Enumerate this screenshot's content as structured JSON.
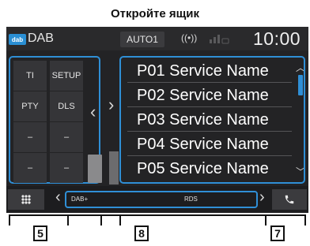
{
  "heading": "Откройте ящик",
  "status_bar": {
    "source_badge": "dab",
    "source_name": "DAB",
    "audio_mode": "AUTO1",
    "radio_icon": "((•))",
    "clock": "10:00"
  },
  "function_panel": {
    "buttons": [
      "TI",
      "SETUP",
      "PTY",
      "DLS",
      "–",
      "–",
      "–",
      "–"
    ],
    "chevron": "‹"
  },
  "preset_list": {
    "chevron": "›",
    "items": [
      "P01 Service Name",
      "P02 Service Name",
      "P03 Service Name",
      "P04 Service Name",
      "P05 Service Name"
    ],
    "scroll_up": "︿",
    "scroll_down": "﹀"
  },
  "bottom_bar": {
    "left_chevron": "‹",
    "right_chevron": "›",
    "info_dab": "DAB+",
    "info_rds": "RDS"
  },
  "callouts": [
    "5",
    "8",
    "7"
  ],
  "colors": {
    "accent": "#2f8fd6",
    "screen_bg": "#232325",
    "button_bg": "#353538"
  },
  "icons": [
    "dab-source-icon",
    "radio-icon",
    "signal-icon",
    "grid-menu-icon",
    "phone-icon"
  ]
}
